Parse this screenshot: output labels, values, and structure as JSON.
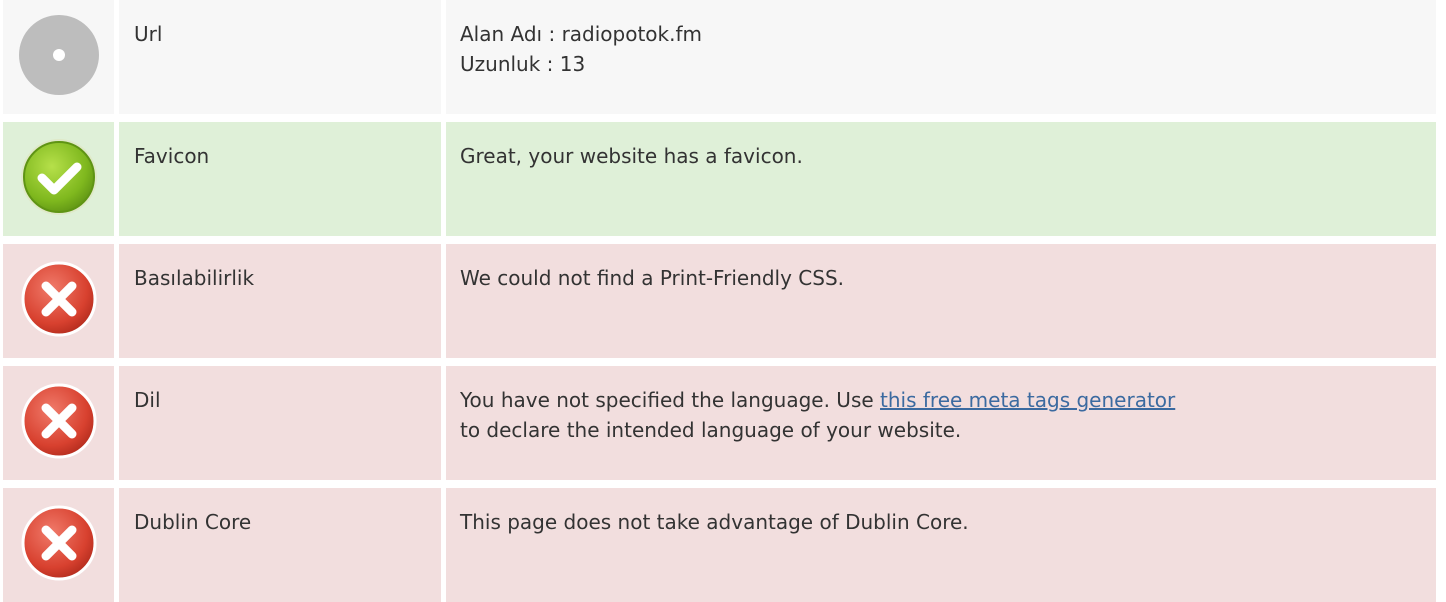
{
  "colors": {
    "neutral_bg": "#f7f7f7",
    "success_bg": "#dff0d8",
    "error_bg": "#f2dede",
    "link": "#3b6aa0"
  },
  "rows": [
    {
      "status": "neutral",
      "icon": "neutral-dot-icon",
      "label": "Url",
      "line1": "Alan Adı : radiopotok.fm",
      "line2": "Uzunluk : 13"
    },
    {
      "status": "success",
      "icon": "check-icon",
      "label": "Favicon",
      "line1": "Great, your website has a favicon."
    },
    {
      "status": "error",
      "icon": "error-x-icon",
      "label": "Basılabilirlik",
      "line1": "We could not find a Print-Friendly CSS."
    },
    {
      "status": "error",
      "icon": "error-x-icon",
      "label": "Dil",
      "line1_prefix": "You have not specified the language. Use ",
      "line1_link": "this free meta tags generator",
      "line2": "to declare the intended language of your website."
    },
    {
      "status": "error",
      "icon": "error-x-icon",
      "label": "Dublin Core",
      "line1": "This page does not take advantage of Dublin Core."
    }
  ]
}
